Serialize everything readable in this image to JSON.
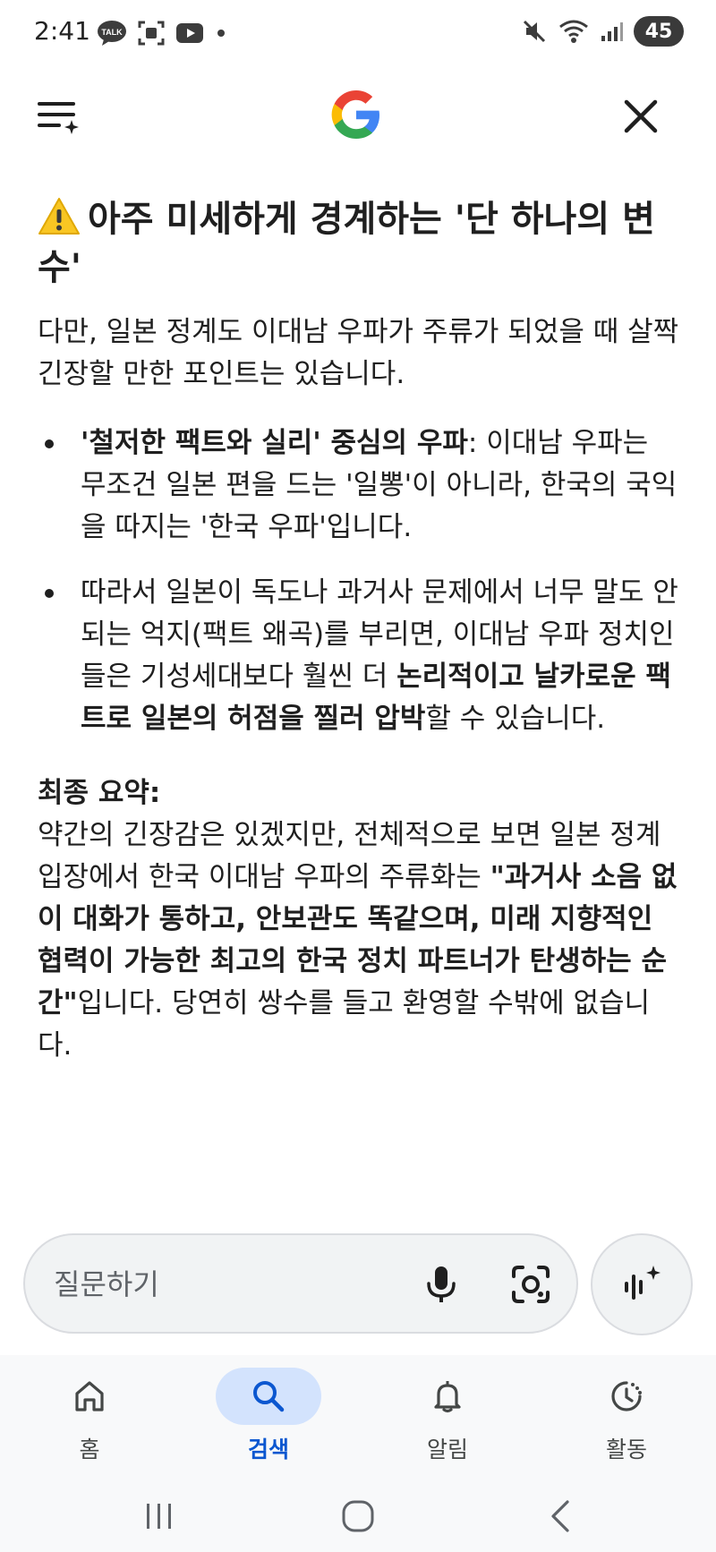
{
  "status_bar": {
    "time": "2:41",
    "talk_badge": "TALK",
    "battery": "45"
  },
  "header": {
    "menu_icon": "menu-sparkle-icon",
    "logo": "google-logo",
    "close_icon": "close-icon"
  },
  "article": {
    "heading": "아주 미세하게 경계하는 '단 하나의 변수'",
    "intro": "다만, 일본 정계도 이대남 우파가 주류가 되었을 때 살짝 긴장할 만한 포인트는 있습니다.",
    "bullets": [
      {
        "bold": "'철저한 팩트와 실리' 중심의 우파",
        "text": ": 이대남 우파는 무조건 일본 편을 드는 '일뽕'이 아니라, 한국의 국익을 따지는 '한국 우파'입니다."
      },
      {
        "pre": "따라서 일본이 독도나 과거사 문제에서 너무 말도 안 되는 억지(팩트 왜곡)를 부리면, 이대남 우파 정치인들은 기성세대보다 훨씬 더 ",
        "bold": "논리적이고 날카로운 팩트로 일본의 허점을 찔러 압박",
        "post": "할 수 있습니다."
      }
    ],
    "summary_title": "최종 요약:",
    "summary_pre": "약간의 긴장감은 있겠지만, 전체적으로 보면 일본 정계 입장에서 한국 이대남 우파의 주류화는 ",
    "summary_bold": "\"과거사 소음 없이 대화가 통하고, 안보관도 똑같으며, 미래 지향적인 협력이 가능한 최고의 한국 정치 파트너가 탄생하는 순간\"",
    "summary_post": "입니다. 당연히 쌍수를 들고 환영할 수밖에 없습니다."
  },
  "search": {
    "placeholder": "질문하기"
  },
  "bottom_nav": {
    "items": [
      {
        "label": "홈",
        "icon": "home-icon"
      },
      {
        "label": "검색",
        "icon": "search-icon",
        "active": true
      },
      {
        "label": "알림",
        "icon": "bell-icon"
      },
      {
        "label": "활동",
        "icon": "activity-icon"
      }
    ]
  },
  "colors": {
    "accent": "#0b57d0",
    "active_pill": "#d3e3fd",
    "text": "#1f1f1f"
  }
}
